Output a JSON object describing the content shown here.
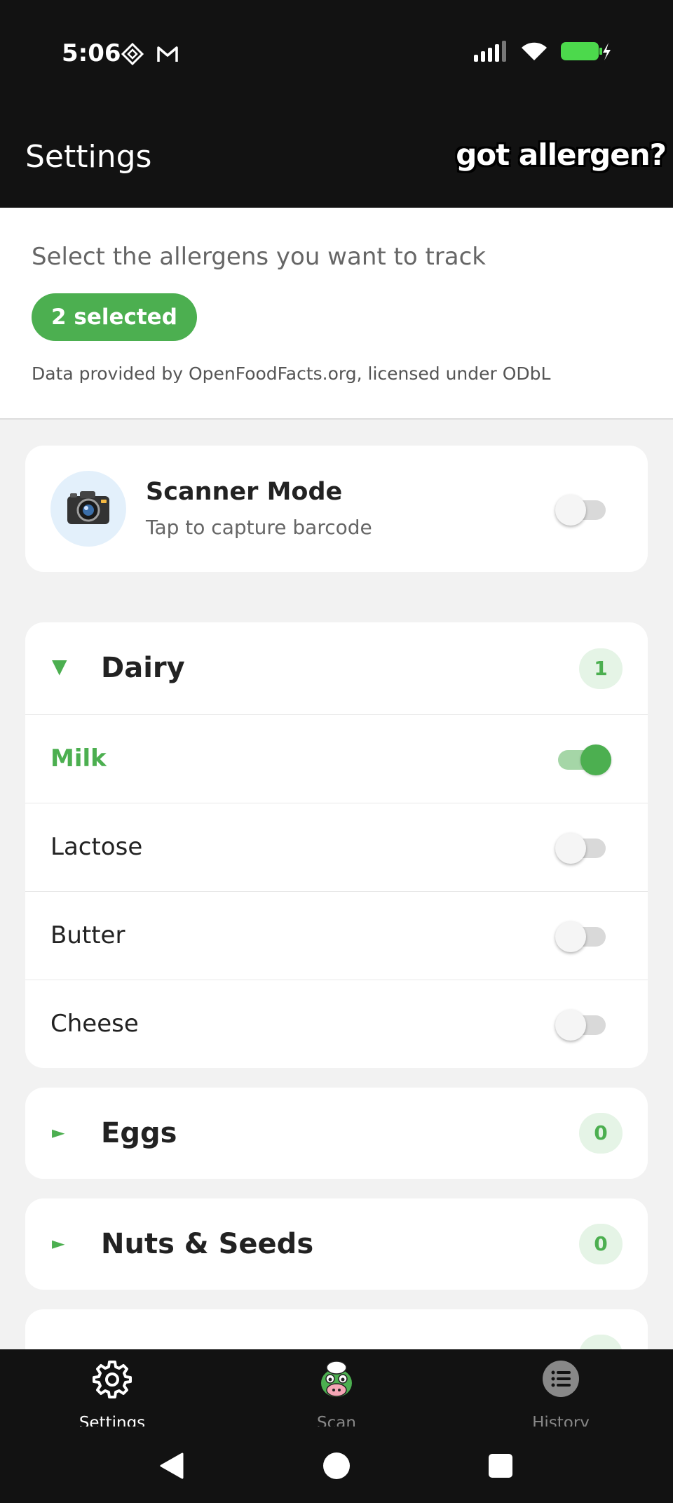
{
  "status_bar": {
    "time": "5:06",
    "icons": [
      "diamond-app-icon",
      "gmail-icon",
      "signal-icon",
      "wifi-icon",
      "battery-charging-icon"
    ],
    "battery_color": "#4cd94c"
  },
  "app_bar": {
    "title": "Settings",
    "brand": "got allergen?"
  },
  "header": {
    "prompt": "Select the allergens you want to track",
    "selected_count_label": "2 selected",
    "data_note": "Data provided by OpenFoodFacts.org, licensed under ODbL"
  },
  "scanner": {
    "title": "Scanner Mode",
    "subtitle": "Tap to capture barcode",
    "icon": "camera-icon",
    "enabled": false
  },
  "categories": [
    {
      "name": "Dairy",
      "count": "1",
      "expanded": true,
      "items": [
        {
          "label": "Milk",
          "enabled": true
        },
        {
          "label": "Lactose",
          "enabled": false
        },
        {
          "label": "Butter",
          "enabled": false
        },
        {
          "label": "Cheese",
          "enabled": false
        }
      ]
    },
    {
      "name": "Eggs",
      "count": "0",
      "expanded": false
    },
    {
      "name": "Nuts & Seeds",
      "count": "0",
      "expanded": false
    }
  ],
  "bottom_nav": [
    {
      "label": "Settings",
      "icon": "gear-icon",
      "active": true
    },
    {
      "label": "Scan",
      "icon": "mascot-icon",
      "active": false
    },
    {
      "label": "History",
      "icon": "list-icon",
      "active": false
    }
  ],
  "colors": {
    "accent": "#4caf50",
    "accent_light": "#e5f4e6",
    "dark_bar": "#121212",
    "background": "#f2f2f2"
  }
}
